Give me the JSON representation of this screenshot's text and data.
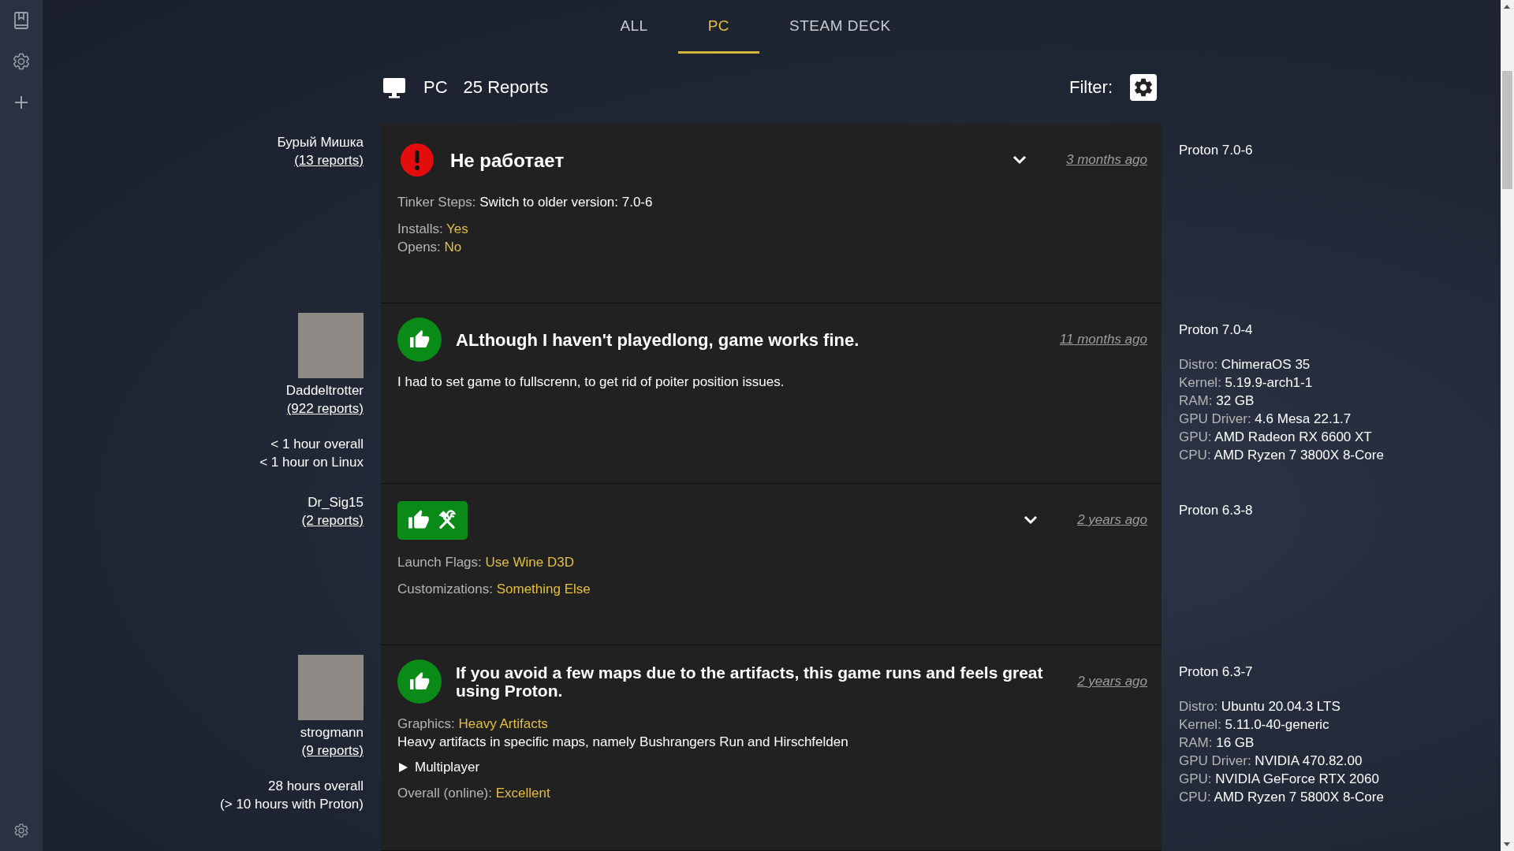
{
  "tabs": [
    {
      "label": "ALL",
      "selected": false
    },
    {
      "label": "PC",
      "selected": true
    },
    {
      "label": "STEAM DECK",
      "selected": false
    }
  ],
  "header": {
    "platform": "PC",
    "count": "25 Reports",
    "filter_label": "Filter:"
  },
  "reports": [
    {
      "user": {
        "name": "Бурый Мишка",
        "reports": "(13 reports)",
        "avatar": false
      },
      "kind": "borked",
      "title": "Не работает",
      "expandable": true,
      "date": "3 months ago",
      "details": [
        [
          {
            "kind": "field",
            "label": "Tinker Steps:",
            "value": "Switch to older version: 7.0-6",
            "accent": false
          }
        ],
        [
          {
            "kind": "field",
            "label": "Installs:",
            "value": "Yes",
            "accent": true
          },
          {
            "kind": "field",
            "label": "Opens:",
            "value": "No",
            "accent": true
          }
        ]
      ],
      "proton": "Proton 7.0-6"
    },
    {
      "user": {
        "name": "Daddeltrotter",
        "reports": "(922 reports)",
        "avatar": true,
        "playtime": [
          "< 1 hour overall",
          "< 1 hour on Linux"
        ]
      },
      "kind": "works",
      "title": "ALthough I haven't playedlong, game works fine.",
      "expandable": false,
      "date": "11 months ago",
      "details": [
        [
          {
            "kind": "text",
            "text": "I had to set game to fullscrenn, to get rid of poiter position issues."
          }
        ]
      ],
      "proton": "Proton 7.0-4",
      "system": [
        {
          "label": "Distro:",
          "value": "ChimeraOS 35"
        },
        {
          "label": "Kernel:",
          "value": "5.19.9-arch1-1"
        },
        {
          "label": "RAM:",
          "value": "32 GB"
        },
        {
          "label": "GPU Driver:",
          "value": "4.6 Mesa 22.1.7"
        },
        {
          "label": "GPU:",
          "value": "AMD Radeon RX 6600 XT"
        },
        {
          "label": "CPU:",
          "value": "AMD Ryzen 7 3800X 8-Core"
        }
      ]
    },
    {
      "user": {
        "name": "Dr_Sig15",
        "reports": "(2 reports)",
        "avatar": false
      },
      "kind": "tinker",
      "expandable": true,
      "date": "2 years ago",
      "details": [
        [
          {
            "kind": "field",
            "label": "Launch Flags:",
            "value": "Use Wine D3D",
            "accent": true
          }
        ],
        [
          {
            "kind": "field",
            "label": "Customizations:",
            "value": "Something Else",
            "accent": true
          }
        ]
      ],
      "proton": "Proton 6.3-8"
    },
    {
      "user": {
        "name": "strogmann",
        "reports": "(9 reports)",
        "avatar": true,
        "playtime": [
          "28 hours overall",
          "(> 10 hours with Proton)"
        ]
      },
      "kind": "works",
      "title": "If you avoid a few maps due to the artifacts, this game runs and feels great using Proton.",
      "expandable": false,
      "date": "2 years ago",
      "details": [
        [
          {
            "kind": "field",
            "label": "Graphics:",
            "value": "Heavy Artifacts",
            "accent": true
          },
          {
            "kind": "text",
            "text": "Heavy artifacts in specific maps, namely Bushrangers Run and Hirschfelden"
          }
        ],
        [
          {
            "kind": "section",
            "label": "Multiplayer",
            "expanded": false
          }
        ],
        [
          {
            "kind": "field",
            "label": "Overall (online):",
            "value": "Excellent",
            "accent": true
          }
        ]
      ],
      "proton": "Proton 6.3-7",
      "system": [
        {
          "label": "Distro:",
          "value": "Ubuntu 20.04.3 LTS"
        },
        {
          "label": "Kernel:",
          "value": "5.11.0-40-generic"
        },
        {
          "label": "RAM:",
          "value": "16 GB"
        },
        {
          "label": "GPU Driver:",
          "value": "NVIDIA 470.82.00"
        },
        {
          "label": "GPU:",
          "value": "NVIDIA GeForce RTX 2060"
        },
        {
          "label": "CPU:",
          "value": "AMD Ryzen 7 5800X 8-Core"
        }
      ]
    }
  ]
}
